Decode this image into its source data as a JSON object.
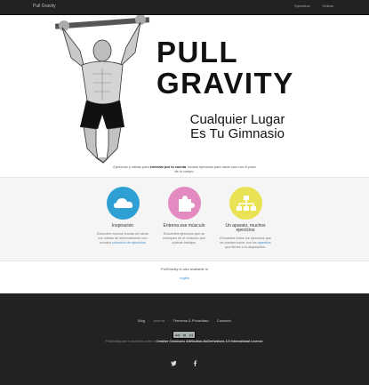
{
  "nav": {
    "brand": "Pull Gravity",
    "links": [
      "Ejercicios",
      "Vídeos"
    ]
  },
  "hero": {
    "title_line1": "PULL",
    "title_line2": "GRAVITY",
    "subtitle_line1": "Cualquier Lugar",
    "subtitle_line2": "Es Tu Gimnasio",
    "intro_before": "Ejercicios y rutinas para ",
    "intro_bold": "entrenar por tu cuenta",
    "intro_after": ", incluso ejercicios para hacer solo con el peso de tu cuerpo."
  },
  "features": [
    {
      "title": "Inspiración",
      "text": "Descubre nuevas formas de variar tus rutinas de entrenamiento con nuestra",
      "link": "colección de ejercicios",
      "color": "#2ea0d4",
      "icon": "cloud-icon"
    },
    {
      "title": "Entrena ese músculo",
      "text": "Encuentra ejercicios que se enfoquen en el músculo que quieras trabajar.",
      "color": "#e38bc1",
      "icon": "puzzle-icon"
    },
    {
      "title": "Un aparato, muchos ejercicios",
      "text_before": "Encuentra todos los ejercicios que se pueden hacer con los ",
      "link": "aparatos",
      "text_after": " que tienes a tu disposición.",
      "color": "#e8e254",
      "icon": "sitemap-icon"
    }
  ],
  "language": {
    "text": "PullGravity is also available in",
    "link": "Inglés"
  },
  "footer": {
    "links": [
      "Blog",
      "Acerca",
      "Términos & Privacidad",
      "Contacto"
    ],
    "license_before": "PullGravity.com is licensed under a ",
    "license_link": "Creative Commons Attribution-NoDerivatives 4.0 International License",
    "license_after": ".",
    "badge": "cc-by-nd-badge",
    "social": [
      "twitter-icon",
      "facebook-icon"
    ]
  },
  "colors": {
    "navbar": "#222222",
    "footer": "#222222",
    "features_bg": "#f5f5f5",
    "link": "#428bca"
  }
}
